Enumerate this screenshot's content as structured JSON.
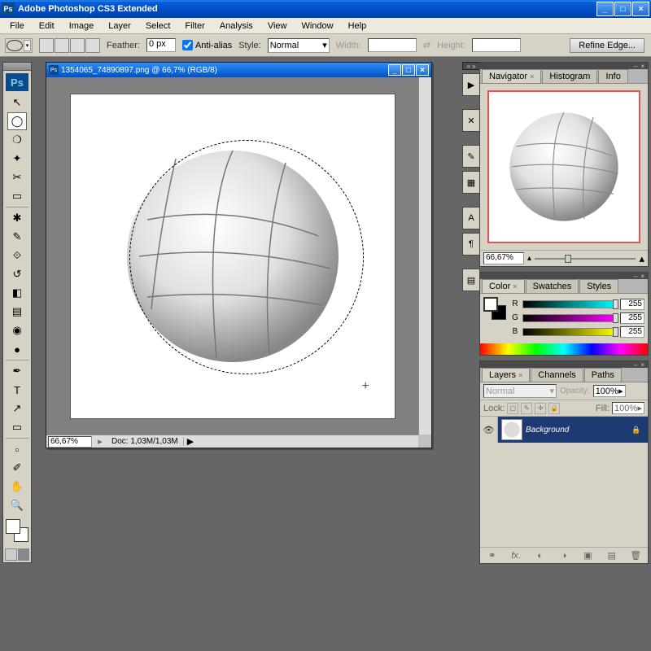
{
  "title": "Adobe Photoshop CS3 Extended",
  "ps_badge": "Ps",
  "menus": [
    "File",
    "Edit",
    "Image",
    "Layer",
    "Select",
    "Filter",
    "Analysis",
    "View",
    "Window",
    "Help"
  ],
  "options": {
    "feather_label": "Feather:",
    "feather_value": "0 px",
    "antialias_label": "Anti-alias",
    "style_label": "Style:",
    "style_value": "Normal",
    "width_label": "Width:",
    "height_label": "Height:",
    "refine_label": "Refine Edge..."
  },
  "document": {
    "title": "1354065_74890897.png @ 66,7% (RGB/8)",
    "zoom": "66,67%",
    "doc_info": "Doc: 1,03M/1,03M"
  },
  "navigator": {
    "tabs": [
      "Navigator",
      "Histogram",
      "Info"
    ],
    "zoom_value": "66,67%"
  },
  "color": {
    "tabs": [
      "Color",
      "Swatches",
      "Styles"
    ],
    "channels": [
      {
        "label": "R",
        "value": "255",
        "gradient": "linear-gradient(to right, #000, cyan)"
      },
      {
        "label": "G",
        "value": "255",
        "gradient": "linear-gradient(to right, #000, magenta)"
      },
      {
        "label": "B",
        "value": "255",
        "gradient": "linear-gradient(to right, #000, yellow)"
      }
    ]
  },
  "layers": {
    "tabs": [
      "Layers",
      "Channels",
      "Paths"
    ],
    "blend_mode": "Normal",
    "opacity_label": "Opacity:",
    "opacity_value": "100%",
    "lock_label": "Lock:",
    "fill_label": "Fill:",
    "fill_value": "100%",
    "layer_name": "Background"
  },
  "tools": [
    {
      "name": "move-tool",
      "glyph": "↖"
    },
    {
      "name": "marquee-tool",
      "glyph": "◯",
      "selected": true
    },
    {
      "name": "lasso-tool",
      "glyph": "❍"
    },
    {
      "name": "magic-wand-tool",
      "glyph": "✦"
    },
    {
      "name": "crop-tool",
      "glyph": "✂"
    },
    {
      "name": "slice-tool",
      "glyph": "▭"
    },
    {
      "name": "spot-heal-tool",
      "glyph": "✱"
    },
    {
      "name": "brush-tool",
      "glyph": "✎"
    },
    {
      "name": "clone-stamp-tool",
      "glyph": "⟐"
    },
    {
      "name": "history-brush-tool",
      "glyph": "↺"
    },
    {
      "name": "eraser-tool",
      "glyph": "◧"
    },
    {
      "name": "gradient-tool",
      "glyph": "▤"
    },
    {
      "name": "blur-tool",
      "glyph": "◉"
    },
    {
      "name": "dodge-tool",
      "glyph": "●"
    },
    {
      "name": "pen-tool",
      "glyph": "✒"
    },
    {
      "name": "type-tool",
      "glyph": "T"
    },
    {
      "name": "path-select-tool",
      "glyph": "↗"
    },
    {
      "name": "shape-tool",
      "glyph": "▭"
    },
    {
      "name": "notes-tool",
      "glyph": "▫"
    },
    {
      "name": "eyedropper-tool",
      "glyph": "✐"
    },
    {
      "name": "hand-tool",
      "glyph": "✋"
    },
    {
      "name": "zoom-tool",
      "glyph": "🔍"
    }
  ]
}
